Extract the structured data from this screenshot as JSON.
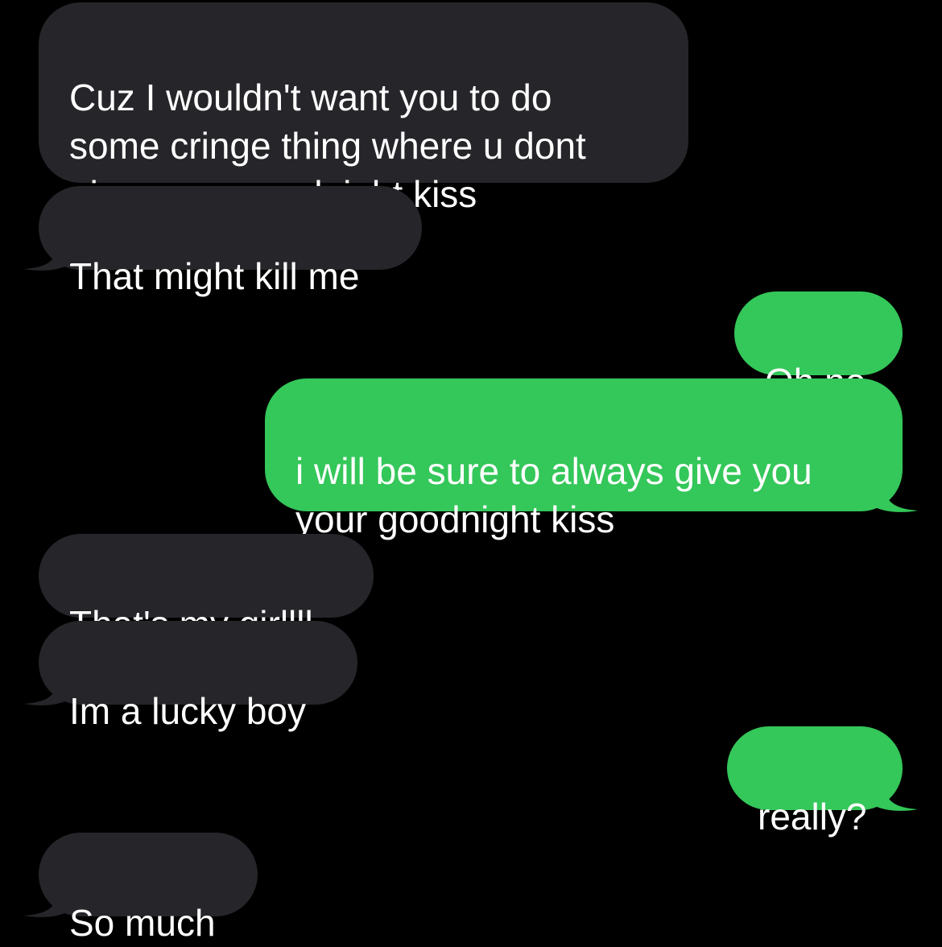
{
  "colors": {
    "background": "#000000",
    "received_bubble": "#26252a",
    "sent_bubble": "#34c759",
    "text": "#ffffff"
  },
  "messages": [
    {
      "direction": "received",
      "text": "Cuz I wouldn't want you to do\nsome cringe thing where u dont\ngive me a goodnight kiss",
      "tail": false
    },
    {
      "direction": "received",
      "text": "That might kill me",
      "tail": true
    },
    {
      "direction": "sent",
      "text": "Oh no",
      "tail": false
    },
    {
      "direction": "sent",
      "text": "i will be sure to always give you\nyour goodnight kiss",
      "tail": true
    },
    {
      "direction": "received",
      "text": "That's my girllll",
      "tail": false
    },
    {
      "direction": "received",
      "text": "Im a lucky boy",
      "tail": true
    },
    {
      "direction": "sent",
      "text": "really?",
      "tail": true
    },
    {
      "direction": "received",
      "text": "So much",
      "tail": true
    }
  ]
}
